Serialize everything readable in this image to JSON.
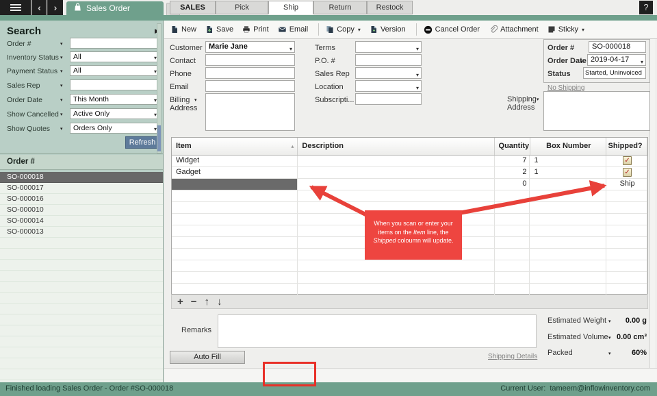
{
  "colors": {
    "teal": "#6fa08c",
    "sidebar_bg": "#b9cfc6",
    "annotation_red": "#ee4540",
    "selected_row_gray": "#686868",
    "refresh_button_blue": "#5d7a9a"
  },
  "icons": {
    "hamburger": "menu-bars",
    "back": "‹",
    "forward": "›",
    "new_tab": "+",
    "help": "?",
    "collapse": "▶",
    "dropdown": "▾",
    "sort_asc": "▴",
    "check": "✓",
    "add": "+",
    "remove": "−",
    "move_up": "↑",
    "move_down": "↓"
  },
  "titlebar": {
    "tab_label": "Sales Order"
  },
  "search": {
    "title": "Search",
    "fields": [
      {
        "label": "Order #",
        "value": "",
        "type": "input"
      },
      {
        "label": "Inventory Status",
        "value": "All",
        "type": "select"
      },
      {
        "label": "Payment Status",
        "value": "All",
        "type": "select"
      },
      {
        "label": "Sales Rep",
        "value": "",
        "type": "input"
      },
      {
        "label": "Order Date",
        "value": "This Month",
        "type": "select"
      },
      {
        "label": "Show Cancelled",
        "value": "Active Only",
        "type": "select"
      },
      {
        "label": "Show Quotes",
        "value": "Orders Only",
        "type": "select"
      }
    ],
    "refresh_label": "Refresh",
    "list_header": "Order #",
    "orders": [
      "SO-000018",
      "SO-000017",
      "SO-000016",
      "SO-000010",
      "SO-000014",
      "SO-000013"
    ],
    "selected_order": "SO-000018"
  },
  "toolbar": {
    "new": "New",
    "save": "Save",
    "print": "Print",
    "email": "Email",
    "copy": "Copy",
    "version": "Version",
    "cancel_order": "Cancel Order",
    "attachment": "Attachment",
    "sticky": "Sticky"
  },
  "form": {
    "customer_label": "Customer",
    "customer_value": "Marie Jane",
    "contact_label": "Contact",
    "phone_label": "Phone",
    "email_label": "Email",
    "billing_line1": "Billing",
    "billing_line2": "Address",
    "terms_label": "Terms",
    "po_label": "P.O. #",
    "sales_rep_label": "Sales Rep",
    "location_label": "Location",
    "subscription_label": "Subscripti...",
    "order_no_label": "Order #",
    "order_no_value": "SO-000018",
    "order_date_label": "Order Date",
    "order_date_value": "2019-04-17",
    "status_label": "Status",
    "status_value": "Started, Uninvoiced",
    "no_shipping_link": "No Shipping",
    "shipping_line1": "Shipping",
    "shipping_line2": "Address"
  },
  "table": {
    "columns": [
      "Item",
      "Description",
      "Quantity",
      "Box Number",
      "Shipped?"
    ],
    "rows": [
      {
        "item": "Widget",
        "description": "",
        "quantity": "7",
        "box_number": "1",
        "shipped": "checked"
      },
      {
        "item": "Gadget",
        "description": "",
        "quantity": "2",
        "box_number": "1",
        "shipped": "checked"
      },
      {
        "item": "",
        "description": "",
        "quantity": "0",
        "box_number": "",
        "shipped": "Ship"
      }
    ]
  },
  "annotation": {
    "part1": "When you scan or enter your items on the ",
    "italic1": "Item",
    "part2": "  line, the ",
    "italic2": "Shipped",
    "part3": " coloumn will update."
  },
  "footer": {
    "remarks_label": "Remarks",
    "auto_fill_label": "Auto Fill",
    "shipping_details_link": "Shipping Details",
    "totals": [
      {
        "label": "Estimated Weight",
        "value": "0.00 g"
      },
      {
        "label": "Estimated Volume",
        "value": "0.00 cm³"
      },
      {
        "label": "Packed",
        "value": "60%"
      }
    ]
  },
  "tabs": [
    "SALES",
    "Pick",
    "Ship",
    "Return",
    "Restock"
  ],
  "statusbar": {
    "left": "Finished loading Sales Order - Order #SO-000018",
    "right_label": "Current User:",
    "right_value": "tameem@inflowinventory.com"
  }
}
